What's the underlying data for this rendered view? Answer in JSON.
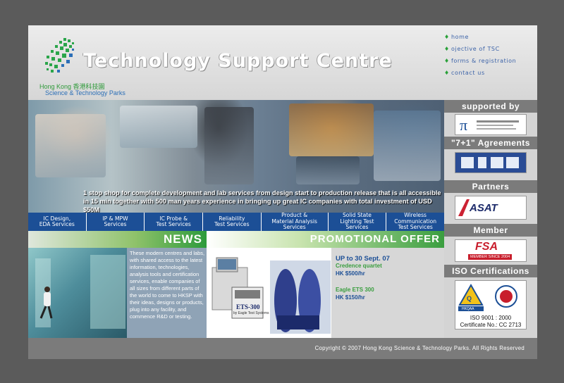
{
  "header": {
    "site_title": "Technology Support Centre",
    "org_line1": "Hong Kong 香港科技園",
    "org_line2": "Science & Technology Parks"
  },
  "top_nav": [
    {
      "label": "home"
    },
    {
      "label": "ojective of TSC"
    },
    {
      "label": "forms & registration"
    },
    {
      "label": "contact us"
    }
  ],
  "hero": {
    "caption_line1": "1 stop shop for complete development and lab services from design start to production release that is all accessible",
    "caption_line2": "in 15 min together with 500 man years experience in bringing up great IC companies with total investment of USD $50M"
  },
  "services": [
    {
      "line1": "IC Design,",
      "line2": "EDA Services"
    },
    {
      "line1": "IP & MPW",
      "line2": "Services"
    },
    {
      "line1": "IC Probe &",
      "line2": "Test Services"
    },
    {
      "line1": "Reliability",
      "line2": "Test Services"
    },
    {
      "line1": "Product &",
      "line2": "Material Analysis",
      "line3": "Services"
    },
    {
      "line1": "Solid State",
      "line2": "Lighting Test",
      "line3": "Services"
    },
    {
      "line1": "Wireless",
      "line2": "Communication",
      "line3": "Test Services"
    }
  ],
  "news": {
    "title": "NEWS",
    "text": "These modern centres and labs, with shared access to the latest information, technologies, analysis tools and certification services, enable companies of all sizes from different parts of the world to come to HKSP with their ideas, designs or products, plug into any facility, and commence R&D or testing."
  },
  "promo": {
    "title": "PROMOTIONAL OFFER",
    "date": "UP to 30 Sept. 07",
    "item1_name": "Credence quartet",
    "item1_price": "HK $500/hr",
    "item2_name": "Eagle ETS 300",
    "item2_price": "HK $150/hr",
    "product_label": "ETS-300",
    "product_sub": "by Eagle Test Systems"
  },
  "sidebar": {
    "supported_by": "supported by",
    "agreements": "\"7+1\" Agreements",
    "partners": "Partners",
    "member": "Member",
    "iso": "ISO Certifications",
    "asat_logo": "ASAT",
    "fsa_logo": "FSA",
    "fsa_sub": "MEMBER SINCE 2004",
    "iso_line1": "ISO 9001 : 2000",
    "iso_line2": "Certificate No.: CC 2713",
    "hkqaa": "HKQAA"
  },
  "footer": {
    "copyright": "Copyright © 2007 Hong Kong Science & Technology Parks. All Rights Reserved"
  },
  "colors": {
    "navy": "#1c4f96",
    "green": "#3a9e3f",
    "gray_bar": "#7b7b7b"
  }
}
